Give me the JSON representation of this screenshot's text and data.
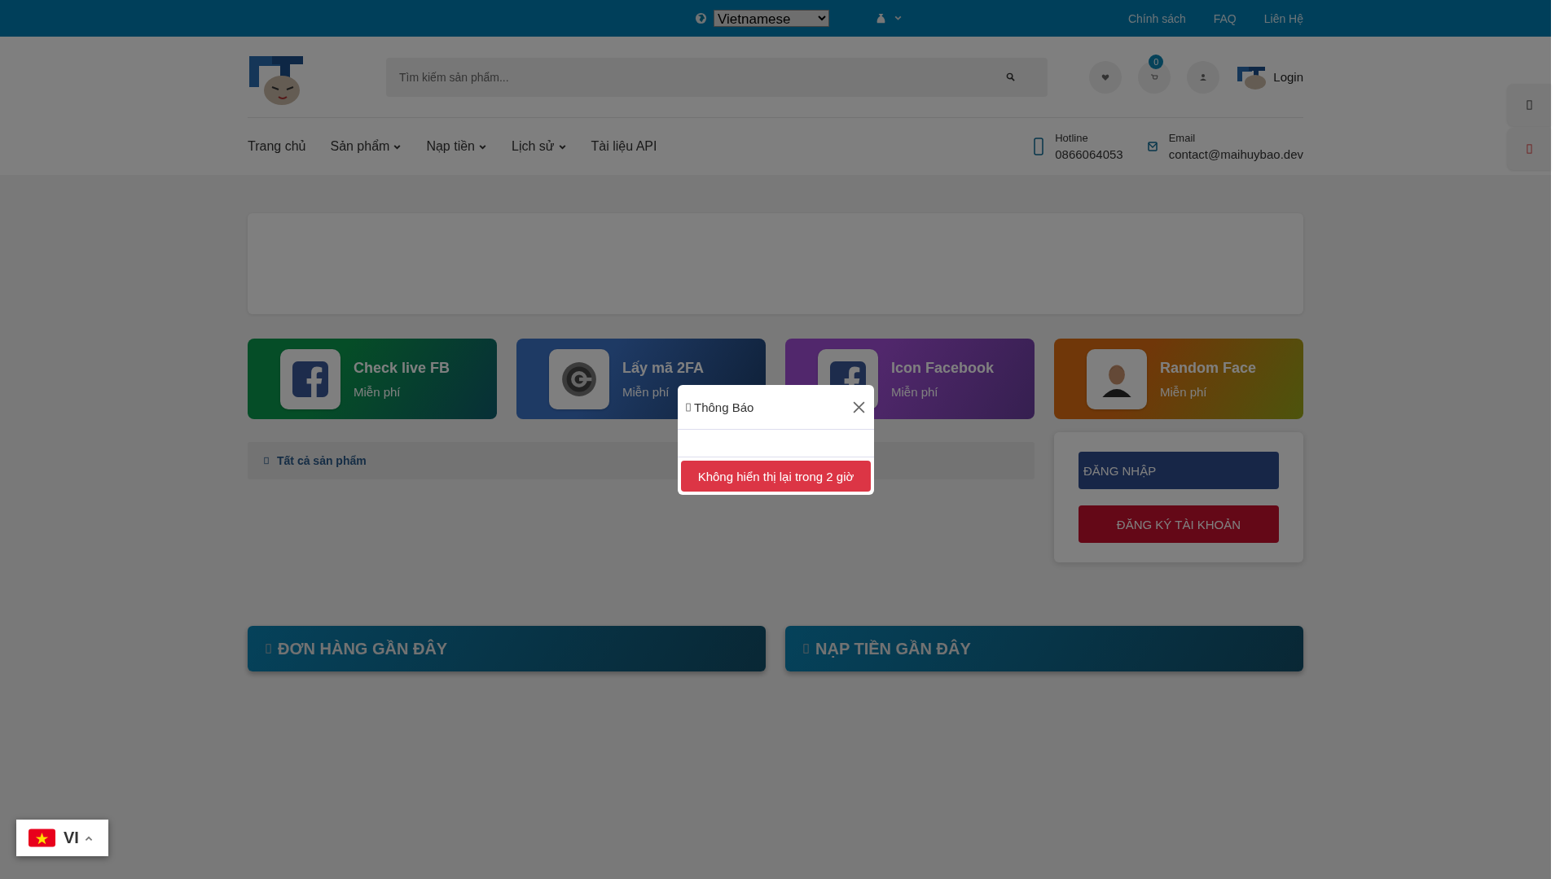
{
  "top_bar": {
    "language_select": "Vietnamese",
    "links": [
      "Chính sách",
      "FAQ",
      "Liên Hệ"
    ]
  },
  "header": {
    "search": {
      "placeholder": "Tìm kiếm sản phẩm..."
    },
    "cart_count": "0",
    "login": "Login"
  },
  "nav": [
    {
      "label": "Trang chủ",
      "dropdown": false
    },
    {
      "label": "Sản phẩm",
      "dropdown": true
    },
    {
      "label": "Nạp tiền",
      "dropdown": true
    },
    {
      "label": "Lịch sử",
      "dropdown": true
    },
    {
      "label": "Tài liệu API",
      "dropdown": false
    }
  ],
  "contacts": [
    {
      "kind": "phone",
      "label": "Hotline",
      "value": "0866064053"
    },
    {
      "kind": "email",
      "label": "Email",
      "value": "contact@maihuybao.dev"
    }
  ],
  "tools": [
    {
      "kind": "facebook",
      "title": "Check live FB",
      "subtitle": "Miễn phí"
    },
    {
      "kind": "authenticator",
      "title": "Lấy mã 2FA",
      "subtitle": "Miễn phí"
    },
    {
      "kind": "facebook",
      "title": "Icon Facebook",
      "subtitle": "Miễn phí"
    },
    {
      "kind": "face",
      "title": "Random Face",
      "subtitle": "Miễn phí"
    }
  ],
  "products_bar": "Tất cả sản phẩm",
  "auth_buttons": [
    {
      "kind": "login",
      "label": "ĐĂNG NHẬP"
    },
    {
      "kind": "register",
      "label": "ĐĂNG KÝ TÀI KHOẢN"
    }
  ],
  "sections": [
    "ĐƠN HÀNG GẦN ĐÂY",
    "NẠP TIỀN GẦN ĐÂY"
  ],
  "modal": {
    "title": "Thông Báo",
    "button": "Không hiển thị lại trong 2 giờ"
  },
  "language_widget": {
    "code": "VI"
  }
}
